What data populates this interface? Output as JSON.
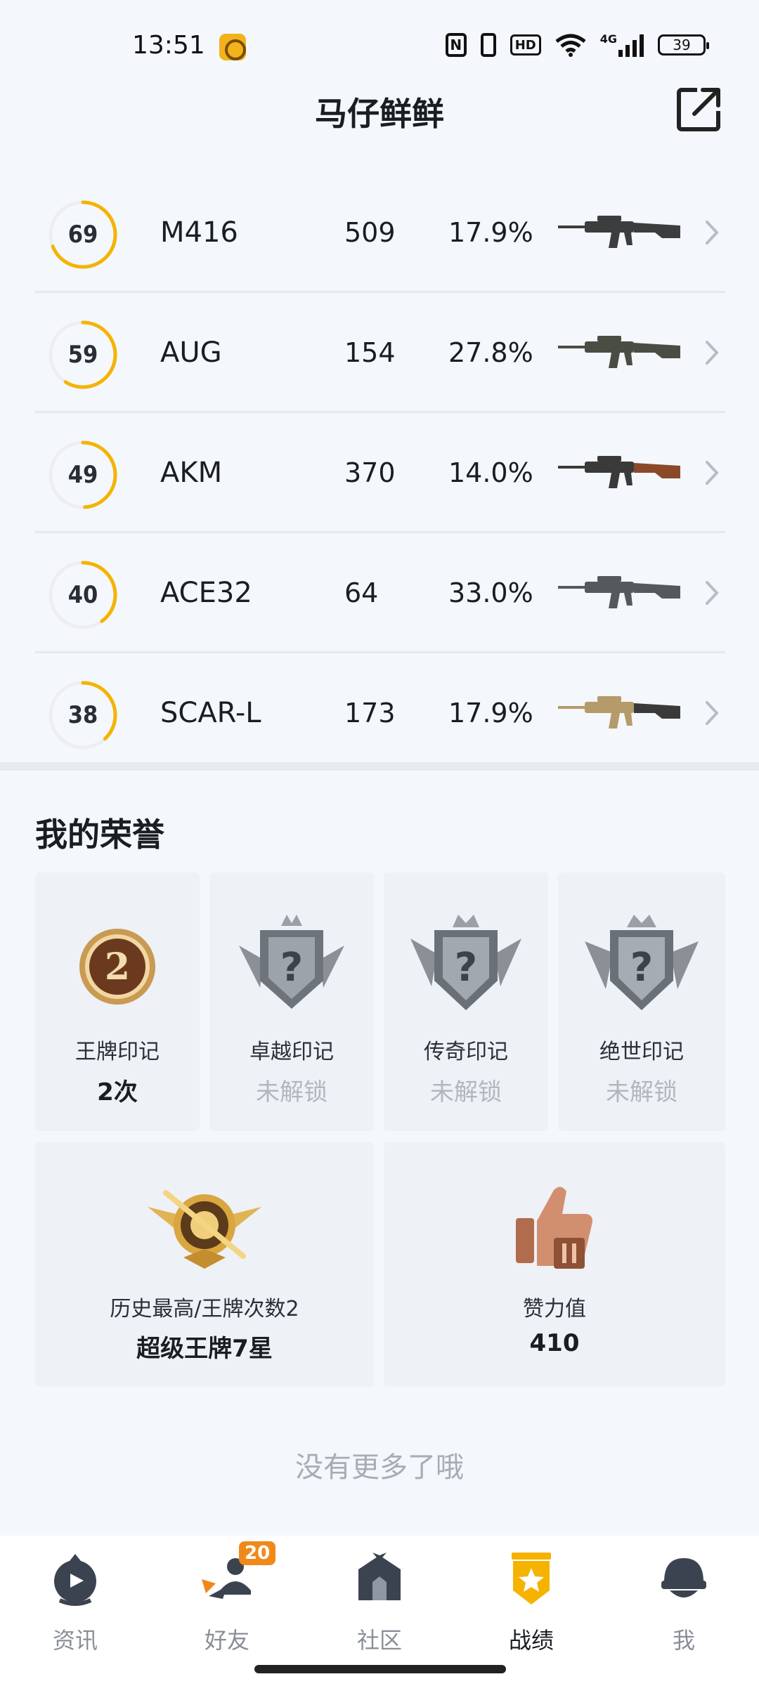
{
  "status_bar": {
    "time": "13:51",
    "hd": "HD",
    "network": "4G",
    "battery": "39"
  },
  "header": {
    "title": "马仔鲜鲜",
    "share_icon": "share-icon"
  },
  "weapons": [
    {
      "score": "69",
      "score_fraction": 0.69,
      "name": "M416",
      "kills": "509",
      "rate": "17.9%",
      "gun_color": "#3b3d3f",
      "stock_color": "#3b3d3f"
    },
    {
      "score": "59",
      "score_fraction": 0.59,
      "name": "AUG",
      "kills": "154",
      "rate": "27.8%",
      "gun_color": "#4a4d44",
      "stock_color": "#4a4d44"
    },
    {
      "score": "49",
      "score_fraction": 0.49,
      "name": "AKM",
      "kills": "370",
      "rate": "14.0%",
      "gun_color": "#3a3a3a",
      "stock_color": "#8a4a2a"
    },
    {
      "score": "40",
      "score_fraction": 0.4,
      "name": "ACE32",
      "kills": "64",
      "rate": "33.0%",
      "gun_color": "#55585c",
      "stock_color": "#55585c"
    },
    {
      "score": "38",
      "score_fraction": 0.38,
      "name": "SCAR-L",
      "kills": "173",
      "rate": "17.9%",
      "gun_color": "#b59a6a",
      "stock_color": "#3a3a3a"
    }
  ],
  "honors": {
    "title": "我的荣誉",
    "cards": [
      {
        "label": "王牌印记",
        "value": "2次",
        "locked": false,
        "badge_text": "2"
      },
      {
        "label": "卓越印记",
        "value": "未解锁",
        "locked": true,
        "badge_text": "?"
      },
      {
        "label": "传奇印记",
        "value": "未解锁",
        "locked": true,
        "badge_text": "?"
      },
      {
        "label": "绝世印记",
        "value": "未解锁",
        "locked": true,
        "badge_text": "?"
      }
    ],
    "history": {
      "label": "历史最高/王牌次数2",
      "value": "超级王牌7星"
    },
    "likes": {
      "label": "赞力值",
      "value": "410"
    }
  },
  "no_more": "没有更多了哦",
  "nav": {
    "items": [
      {
        "label": "资讯",
        "icon": "news-icon"
      },
      {
        "label": "好友",
        "icon": "friends-icon",
        "badge": "20"
      },
      {
        "label": "社区",
        "icon": "community-icon"
      },
      {
        "label": "战绩",
        "icon": "records-icon",
        "active": true
      },
      {
        "label": "我",
        "icon": "profile-icon"
      }
    ]
  },
  "colors": {
    "accent": "#f5b300",
    "ring_track": "#eceef2",
    "locked_text": "#b3b7bd"
  }
}
